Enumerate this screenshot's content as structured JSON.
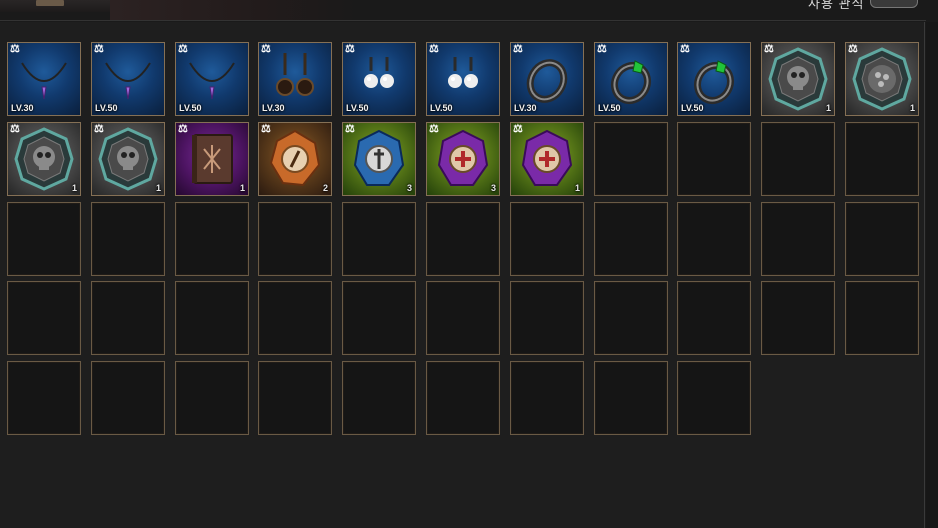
{
  "header": {
    "toggle_label": "사용 관식"
  },
  "inventory": {
    "items": [
      {
        "name": "slot-item-necklace",
        "icon": "necklace-icon",
        "level": "LV.30",
        "qty": "",
        "bg": "blue"
      },
      {
        "name": "slot-item-necklace",
        "icon": "necklace-icon",
        "level": "LV.50",
        "qty": "",
        "bg": "blue"
      },
      {
        "name": "slot-item-necklace",
        "icon": "necklace-icon",
        "level": "LV.50",
        "qty": "",
        "bg": "blue"
      },
      {
        "name": "slot-item-earring",
        "icon": "earring-icon",
        "level": "LV.30",
        "qty": "",
        "bg": "blue"
      },
      {
        "name": "slot-item-earring",
        "icon": "pearl-earring-icon",
        "level": "LV.50",
        "qty": "",
        "bg": "blue"
      },
      {
        "name": "slot-item-earring",
        "icon": "pearl-earring-icon",
        "level": "LV.50",
        "qty": "",
        "bg": "blue"
      },
      {
        "name": "slot-item-ring",
        "icon": "ring-icon",
        "level": "LV.30",
        "qty": "",
        "bg": "blue"
      },
      {
        "name": "slot-item-ring",
        "icon": "emerald-ring-icon",
        "level": "LV.50",
        "qty": "",
        "bg": "blue"
      },
      {
        "name": "slot-item-ring",
        "icon": "emerald-ring-icon",
        "level": "LV.50",
        "qty": "",
        "bg": "blue"
      },
      {
        "name": "slot-item-relic",
        "icon": "skull-medallion-icon",
        "level": "",
        "qty": "1",
        "bg": "gray"
      },
      {
        "name": "slot-item-relic",
        "icon": "orb-medallion-icon",
        "level": "",
        "qty": "1",
        "bg": "gray"
      },
      {
        "name": "slot-item-relic",
        "icon": "skull-medallion-icon",
        "level": "",
        "qty": "1",
        "bg": "gray"
      },
      {
        "name": "slot-item-relic",
        "icon": "skull-medallion-icon",
        "level": "",
        "qty": "1",
        "bg": "gray"
      },
      {
        "name": "slot-item-book",
        "icon": "spellbook-icon",
        "level": "",
        "qty": "1",
        "bg": "purple"
      },
      {
        "name": "slot-item-crystal",
        "icon": "compass-crystal-icon",
        "level": "",
        "qty": "2",
        "bg": "orange"
      },
      {
        "name": "slot-item-crystal",
        "icon": "dagger-crystal-icon",
        "level": "",
        "qty": "3",
        "bg": "green"
      },
      {
        "name": "slot-item-crystal",
        "icon": "cross-crystal-icon",
        "level": "",
        "qty": "3",
        "bg": "green"
      },
      {
        "name": "slot-item-crystal",
        "icon": "cross-crystal-icon",
        "level": "",
        "qty": "1",
        "bg": "green"
      }
    ],
    "empty_slots": 35
  }
}
